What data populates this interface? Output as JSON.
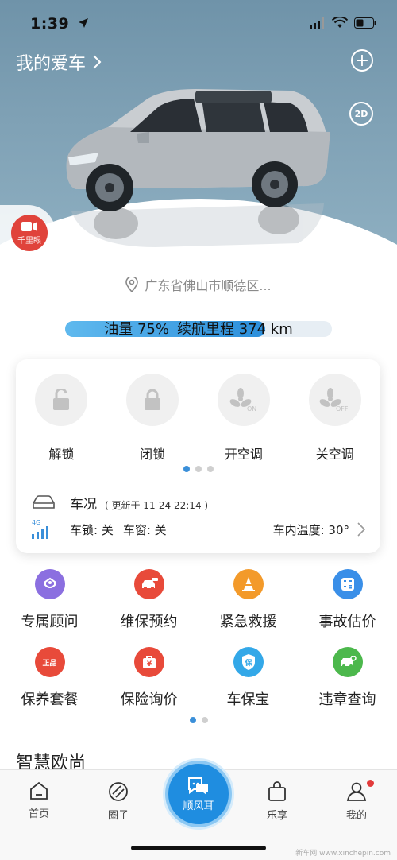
{
  "status_bar": {
    "time": "1:39"
  },
  "header": {
    "title": "我的爱车",
    "view_mode": "2D"
  },
  "qianliyan": {
    "label": "千里眼"
  },
  "location": {
    "text": "广东省佛山市顺德区..."
  },
  "fuel": {
    "fuel_label": "油量 75%",
    "range_label": "续航里程 374 km",
    "fuel_fraction": 0.75
  },
  "controls": [
    {
      "label": "解锁",
      "icon": "unlock-icon"
    },
    {
      "label": "闭锁",
      "icon": "lock-icon"
    },
    {
      "label": "开空调",
      "icon": "fan-on-icon",
      "tag": "ON"
    },
    {
      "label": "关空调",
      "icon": "fan-off-icon",
      "tag": "OFF"
    }
  ],
  "car_status": {
    "title": "车况",
    "updated": "( 更新于 11-24 22:14 )",
    "signal": "4G",
    "lock": "车锁: 关",
    "window": "车窗: 关",
    "temp": "车内温度:  30°"
  },
  "services": [
    {
      "label": "专属顾问",
      "icon": "advisor-icon",
      "color": "#8b6fe0"
    },
    {
      "label": "维保预约",
      "icon": "car-service-icon",
      "color": "#e84a3a"
    },
    {
      "label": "紧急救援",
      "icon": "cone-icon",
      "color": "#f39a2a"
    },
    {
      "label": "事故估价",
      "icon": "calculator-icon",
      "color": "#3a8fe8"
    },
    {
      "label": "保养套餐",
      "icon": "package-icon",
      "color": "#e84a3a",
      "glyph": "正品"
    },
    {
      "label": "保险询价",
      "icon": "insurance-bag-icon",
      "color": "#e84a3a",
      "glyph": "¥"
    },
    {
      "label": "车保宝",
      "icon": "shield-icon",
      "color": "#33a8e8",
      "glyph": "保"
    },
    {
      "label": "违章查询",
      "icon": "violation-car-icon",
      "color": "#4cb84c"
    }
  ],
  "section": {
    "title": "智慧欧尚"
  },
  "tabs": [
    {
      "label": "首页",
      "icon": "home-icon"
    },
    {
      "label": "圈子",
      "icon": "circle-icon"
    },
    {
      "label": "顺风耳",
      "icon": "chat-icon"
    },
    {
      "label": "乐享",
      "icon": "bag-icon"
    },
    {
      "label": "我的",
      "icon": "user-icon"
    }
  ],
  "watermark": "新车网 www.xinchepin.com"
}
